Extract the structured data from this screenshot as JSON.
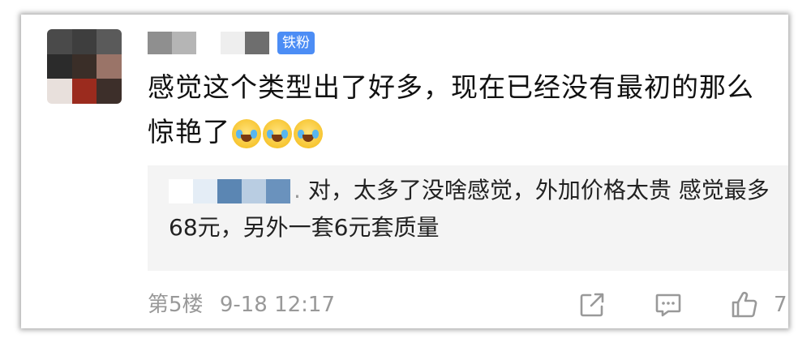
{
  "comment": {
    "badge": "铁粉",
    "text": "感觉这个类型出了好多，现在已经没有最初的那么惊艳了",
    "emojis": [
      "crying-laughing-emoji",
      "crying-laughing-emoji",
      "crying-laughing-emoji"
    ]
  },
  "reply": {
    "separator": ".",
    "text": "对，太多了没啥感觉，外加价格太贵 感觉最多68元，另外一套6元套质量"
  },
  "footer": {
    "floor": "第5楼",
    "timestamp": "9-18 12:17",
    "like_count": "7"
  },
  "colors": {
    "badge": "#4c8df5",
    "reply_bg": "#f4f4f4",
    "meta_text": "#999999"
  }
}
